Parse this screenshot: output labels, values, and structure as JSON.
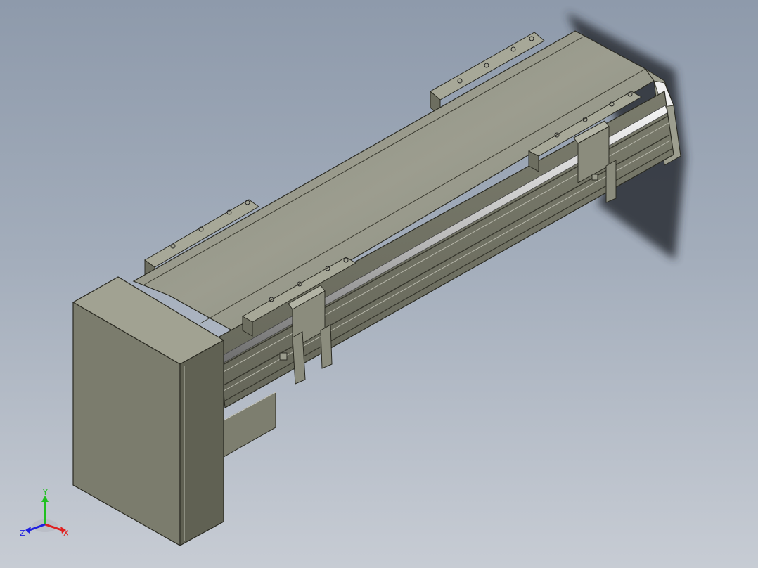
{
  "viewport": {
    "background_top": "#8e9aab",
    "background_bottom": "#c7ccd4"
  },
  "model": {
    "body_color": "#7c7d6e",
    "rail_color": "#dcdcdc"
  },
  "triad": {
    "x_label": "X",
    "y_label": "Y",
    "z_label": "Z",
    "x_color": "#e02020",
    "y_color": "#20c020",
    "z_color": "#2020e0"
  }
}
